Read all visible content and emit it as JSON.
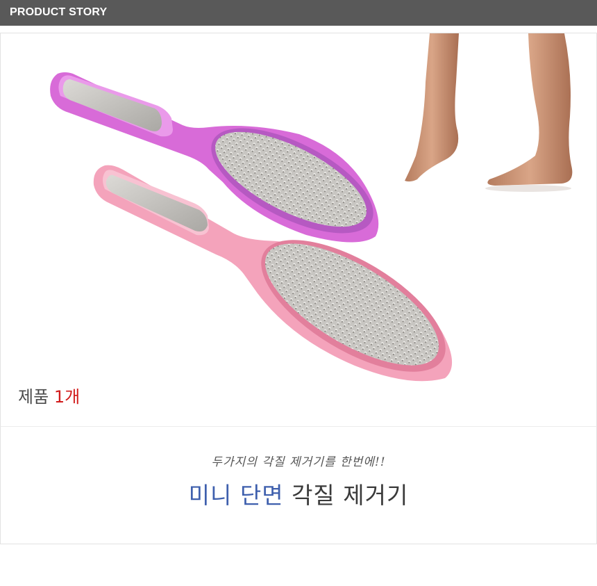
{
  "header": {
    "title": "PRODUCT STORY"
  },
  "product_image": {
    "quantity_label": "제품",
    "quantity_count": "1개",
    "colors": {
      "handle_violet": "#e07ce0",
      "handle_pink": "#f6a9c0",
      "quantity_accent": "#d11a1a"
    }
  },
  "caption": {
    "subtitle": "두가지의 각질 제거기를 한번에!!",
    "title_accent": "미니 단면",
    "title_rest": "각질 제거기",
    "accent_color": "#3e5fad"
  }
}
